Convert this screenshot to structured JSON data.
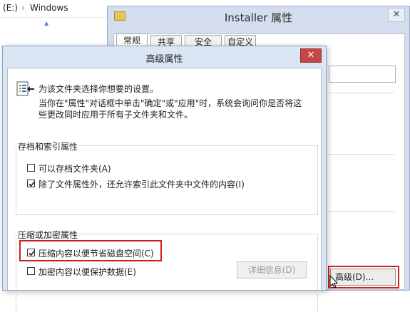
{
  "explorer": {
    "drive": "(E:)",
    "separator": "›",
    "folder": "Windows"
  },
  "properties_window": {
    "title": "Installer 属性",
    "close_glyph": "✕",
    "tabs": [
      {
        "label": "常规",
        "active": true
      },
      {
        "label": "共享",
        "active": false
      },
      {
        "label": "安全",
        "active": false
      },
      {
        "label": "自定义",
        "active": false
      }
    ],
    "advanced_button": "高级(D)..."
  },
  "dialog": {
    "title": "高级属性",
    "close_glyph": "✕",
    "intro_lines": [
      "为该文件夹选择你想要的设置。",
      "当你在\"属性\"对话框中单击\"确定\"或\"应用\"时，系统会询问你是否将这",
      "些更改同时应用于所有子文件夹和文件。"
    ],
    "archive_group": {
      "label": "存档和索引属性",
      "options": [
        {
          "label": "可以存档文件夹(A)",
          "checked": false
        },
        {
          "label": "除了文件属性外，还允许索引此文件夹中文件的内容(I)",
          "checked": true
        }
      ]
    },
    "compress_group": {
      "label": "压缩或加密属性",
      "options": [
        {
          "label": "压缩内容以便节省磁盘空间(C)",
          "checked": true
        },
        {
          "label": "加密内容以便保护数据(E)",
          "checked": false
        }
      ],
      "details_button": "详细信息(D)"
    }
  },
  "colors": {
    "highlight": "#d01f1f",
    "dialog_frame": "#dbe6f4",
    "close_red": "#c74646"
  }
}
